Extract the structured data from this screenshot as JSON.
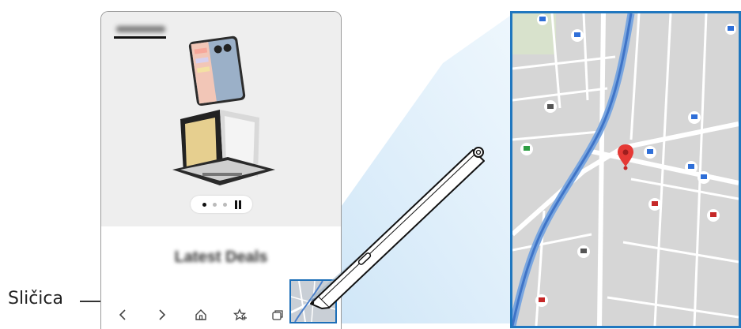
{
  "callout": {
    "label": "Sličica"
  },
  "hero": {
    "carousel_count": 3,
    "carousel_active_index": 1
  },
  "deals": {
    "heading": "Latest Deals"
  },
  "navbar": {
    "items": [
      "back-icon",
      "forward-icon",
      "home-icon",
      "favorites-icon",
      "tabs-icon"
    ]
  },
  "colors": {
    "accent": "#2077bf",
    "map_background": "#d5d5d5",
    "water": "#4a7fc9",
    "pin": "#e53935",
    "poi": "#2f6fd8"
  }
}
